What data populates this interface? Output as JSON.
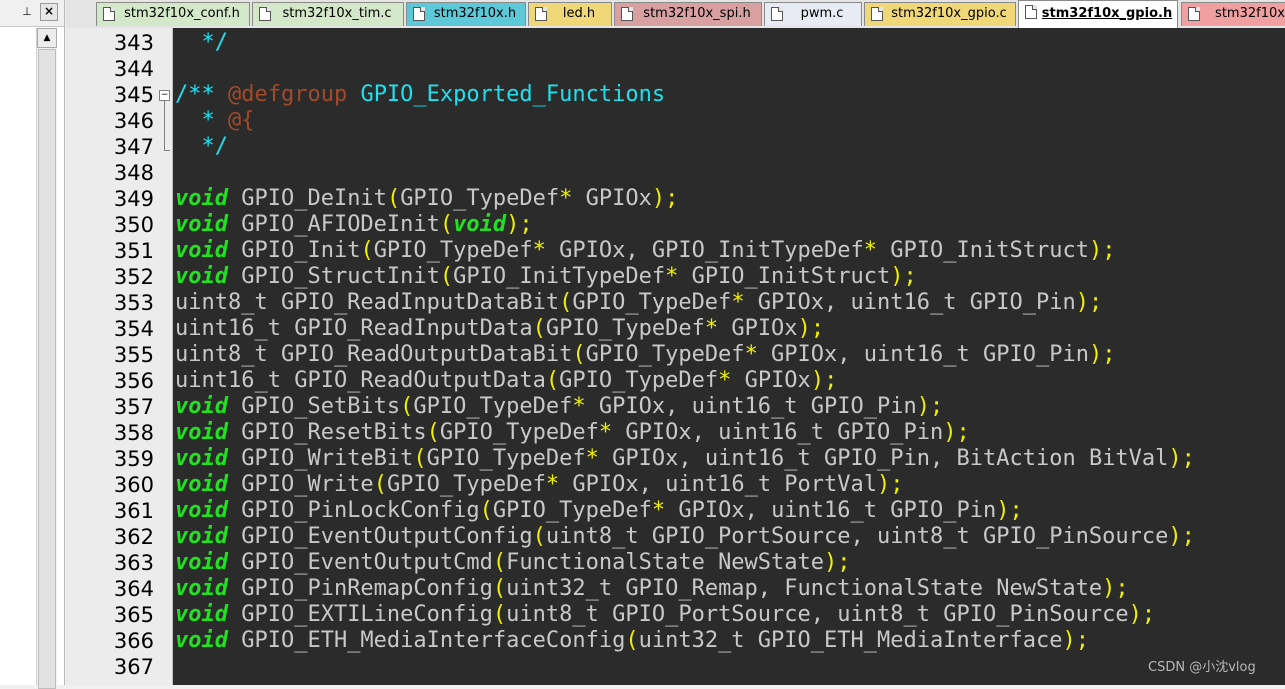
{
  "dock": {
    "pin_glyph": "⊥",
    "close_glyph": "×",
    "scroll_up_glyph": "▲"
  },
  "tabs": [
    {
      "label": "stm32f10x_conf.h",
      "color": "#d2e8c8",
      "active": false
    },
    {
      "label": "stm32f10x_tim.c",
      "color": "#d2e8c8",
      "active": false
    },
    {
      "label": "stm32f10x.h",
      "color": "#5cc8d8",
      "active": false
    },
    {
      "label": "led.h",
      "color": "#f0d878",
      "active": false
    },
    {
      "label": "stm32f10x_spi.h",
      "color": "#d8a0a0",
      "active": false
    },
    {
      "label": "pwm.c",
      "color": "#e8eaf4",
      "active": false
    },
    {
      "label": "stm32f10x_gpio.c",
      "color": "#f0d878",
      "active": false
    },
    {
      "label": "stm32f10x_gpio.h",
      "color": "#ffffff",
      "active": true
    },
    {
      "label": "stm32f10x",
      "color": "#f0a0a0",
      "active": false
    }
  ],
  "editor": {
    "lines": [
      {
        "n": "343",
        "code": "  */"
      },
      {
        "n": "344",
        "code": ""
      },
      {
        "n": "345",
        "code": "/** @defgroup GPIO_Exported_Functions"
      },
      {
        "n": "346",
        "code": "  * @{"
      },
      {
        "n": "347",
        "code": "  */"
      },
      {
        "n": "348",
        "code": ""
      },
      {
        "n": "349",
        "code": "void GPIO_DeInit(GPIO_TypeDef* GPIOx);"
      },
      {
        "n": "350",
        "code": "void GPIO_AFIODeInit(void);"
      },
      {
        "n": "351",
        "code": "void GPIO_Init(GPIO_TypeDef* GPIOx, GPIO_InitTypeDef* GPIO_InitStruct);"
      },
      {
        "n": "352",
        "code": "void GPIO_StructInit(GPIO_InitTypeDef* GPIO_InitStruct);"
      },
      {
        "n": "353",
        "code": "uint8_t GPIO_ReadInputDataBit(GPIO_TypeDef* GPIOx, uint16_t GPIO_Pin);"
      },
      {
        "n": "354",
        "code": "uint16_t GPIO_ReadInputData(GPIO_TypeDef* GPIOx);"
      },
      {
        "n": "355",
        "code": "uint8_t GPIO_ReadOutputDataBit(GPIO_TypeDef* GPIOx, uint16_t GPIO_Pin);"
      },
      {
        "n": "356",
        "code": "uint16_t GPIO_ReadOutputData(GPIO_TypeDef* GPIOx);"
      },
      {
        "n": "357",
        "code": "void GPIO_SetBits(GPIO_TypeDef* GPIOx, uint16_t GPIO_Pin);"
      },
      {
        "n": "358",
        "code": "void GPIO_ResetBits(GPIO_TypeDef* GPIOx, uint16_t GPIO_Pin);"
      },
      {
        "n": "359",
        "code": "void GPIO_WriteBit(GPIO_TypeDef* GPIOx, uint16_t GPIO_Pin, BitAction BitVal);"
      },
      {
        "n": "360",
        "code": "void GPIO_Write(GPIO_TypeDef* GPIOx, uint16_t PortVal);"
      },
      {
        "n": "361",
        "code": "void GPIO_PinLockConfig(GPIO_TypeDef* GPIOx, uint16_t GPIO_Pin);"
      },
      {
        "n": "362",
        "code": "void GPIO_EventOutputConfig(uint8_t GPIO_PortSource, uint8_t GPIO_PinSource);"
      },
      {
        "n": "363",
        "code": "void GPIO_EventOutputCmd(FunctionalState NewState);"
      },
      {
        "n": "364",
        "code": "void GPIO_PinRemapConfig(uint32_t GPIO_Remap, FunctionalState NewState);"
      },
      {
        "n": "365",
        "code": "void GPIO_EXTILineConfig(uint8_t GPIO_PortSource, uint8_t GPIO_PinSource);"
      },
      {
        "n": "366",
        "code": "void GPIO_ETH_MediaInterfaceConfig(uint32_t GPIO_ETH_MediaInterface);"
      },
      {
        "n": "367",
        "code": ""
      }
    ],
    "fold_glyph": "−"
  },
  "colors": {
    "editor_bg": "#2b2b2b",
    "keyword": "#22e022",
    "punctuation": "#f0f000",
    "comment": "#1ee0ee",
    "doc_tag": "#a34a28",
    "text": "#c8c8c8"
  },
  "watermark": "CSDN @小沈vlog"
}
